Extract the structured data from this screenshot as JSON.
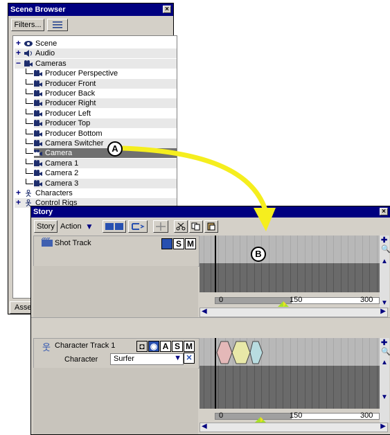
{
  "scene_browser": {
    "title": "Scene Browser",
    "filters_label": "Filters...",
    "tab_label": "Asse",
    "items": [
      {
        "label": "Scene",
        "expander": "+",
        "indent": 0,
        "icon": "scene-icon",
        "shaded": false,
        "selected": false
      },
      {
        "label": "Audio",
        "expander": "+",
        "indent": 0,
        "icon": "audio-icon",
        "shaded": true,
        "selected": false
      },
      {
        "label": "Cameras",
        "expander": "−",
        "indent": 0,
        "icon": "camera-icon",
        "shaded": true,
        "selected": false
      },
      {
        "label": "Producer Perspective",
        "expander": "",
        "indent": 1,
        "icon": "camera-icon",
        "shaded": false,
        "selected": false
      },
      {
        "label": "Producer Front",
        "expander": "",
        "indent": 1,
        "icon": "camera-icon",
        "shaded": true,
        "selected": false
      },
      {
        "label": "Producer Back",
        "expander": "",
        "indent": 1,
        "icon": "camera-icon",
        "shaded": false,
        "selected": false
      },
      {
        "label": "Producer Right",
        "expander": "",
        "indent": 1,
        "icon": "camera-icon",
        "shaded": true,
        "selected": false
      },
      {
        "label": "Producer Left",
        "expander": "",
        "indent": 1,
        "icon": "camera-icon",
        "shaded": false,
        "selected": false
      },
      {
        "label": "Producer Top",
        "expander": "",
        "indent": 1,
        "icon": "camera-icon",
        "shaded": true,
        "selected": false
      },
      {
        "label": "Producer Bottom",
        "expander": "",
        "indent": 1,
        "icon": "camera-icon",
        "shaded": false,
        "selected": false
      },
      {
        "label": "Camera Switcher",
        "expander": "",
        "indent": 1,
        "icon": "camera-icon",
        "shaded": true,
        "selected": false
      },
      {
        "label": "Camera",
        "expander": "",
        "indent": 1,
        "icon": "camera-icon",
        "shaded": false,
        "selected": true
      },
      {
        "label": "Camera 1",
        "expander": "",
        "indent": 1,
        "icon": "camera-icon",
        "shaded": true,
        "selected": false
      },
      {
        "label": "Camera 2",
        "expander": "",
        "indent": 1,
        "icon": "camera-icon",
        "shaded": false,
        "selected": false
      },
      {
        "label": "Camera 3",
        "expander": "",
        "indent": 1,
        "icon": "camera-icon",
        "shaded": true,
        "selected": false
      },
      {
        "label": "Characters",
        "expander": "+",
        "indent": 0,
        "icon": "character-icon",
        "shaded": false,
        "selected": false
      },
      {
        "label": "Control Rigs",
        "expander": "+",
        "indent": 0,
        "icon": "character-icon",
        "shaded": true,
        "selected": false
      }
    ]
  },
  "story": {
    "title": "Story",
    "toolbar": {
      "tab_story": "Story",
      "tab_action": "Action"
    },
    "shot_track": {
      "label": "Shot Track",
      "btn_s": "S",
      "btn_m": "M"
    },
    "character_track": {
      "label": "Character Track 1",
      "btn_a": "A",
      "btn_s": "S",
      "btn_m": "M",
      "character_label": "Character",
      "character_value": "Surfer"
    },
    "timeline": {
      "tick_0": "0",
      "tick_150": "150",
      "tick_300": "300"
    }
  },
  "callouts": {
    "a": "A",
    "b": "B"
  },
  "colors": {
    "title_bg": "#000080",
    "arrow": "#f5ee1e",
    "selection": "#707070",
    "timeline_dark": "#6a6a6a"
  }
}
